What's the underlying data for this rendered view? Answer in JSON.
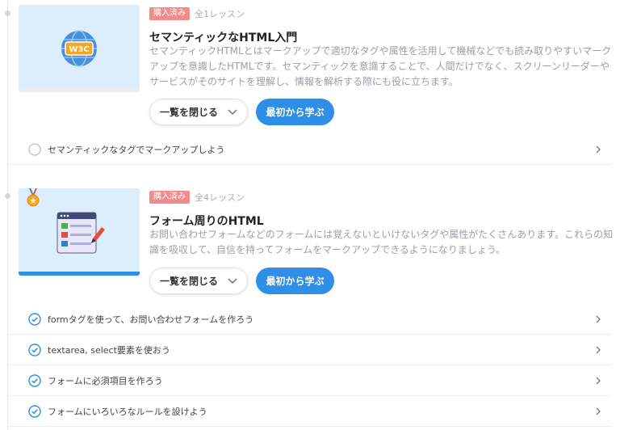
{
  "courses": [
    {
      "badge": "購入済み",
      "lesson_count": "全1レッスン",
      "title": "セマンティックなHTML入門",
      "description": "セマンティックHTMLとはマークアップで適切なタグや属性を活用して機械などでも読み取りやすいマークアップを意識したHTMLです。セマンティックを意識することで、人間だけでなく、スクリーンリーダーやサービスがそのサイトを理解し、情報を解析する際にも役に立ちます。",
      "collapse_label": "一覧を閉じる",
      "learn_label": "最初から学ぶ",
      "thumb_icon": "w3c-globe-icon",
      "lessons": [
        {
          "label": "セマンティックなタグでマークアップしよう",
          "completed": false
        }
      ]
    },
    {
      "badge": "購入済み",
      "lesson_count": "全4レッスン",
      "title": "フォーム周りのHTML",
      "description": "お問い合わせフォームなどのフォームには覚えないといけないタグや属性がたくさんあります。これらの知識を吸収して、自信を持ってフォームをマークアップできるようになりましょう。",
      "collapse_label": "一覧を閉じる",
      "learn_label": "最初から学ぶ",
      "thumb_icon": "form-checklist-icon",
      "lessons": [
        {
          "label": "formタグを使って、お問い合わせフォームを作ろう",
          "completed": true
        },
        {
          "label": "textarea, select要素を使おう",
          "completed": true
        },
        {
          "label": "フォームに必須項目を作ろう",
          "completed": true
        },
        {
          "label": "フォームにいろいろなルールを設けよう",
          "completed": true
        }
      ]
    }
  ],
  "colors": {
    "accent": "#2f8fe6",
    "badge": "#f08c8c",
    "thumb_bg": "#dceefb",
    "progress_bar": "#2f8fe6"
  },
  "course_progress": [
    0,
    1
  ]
}
